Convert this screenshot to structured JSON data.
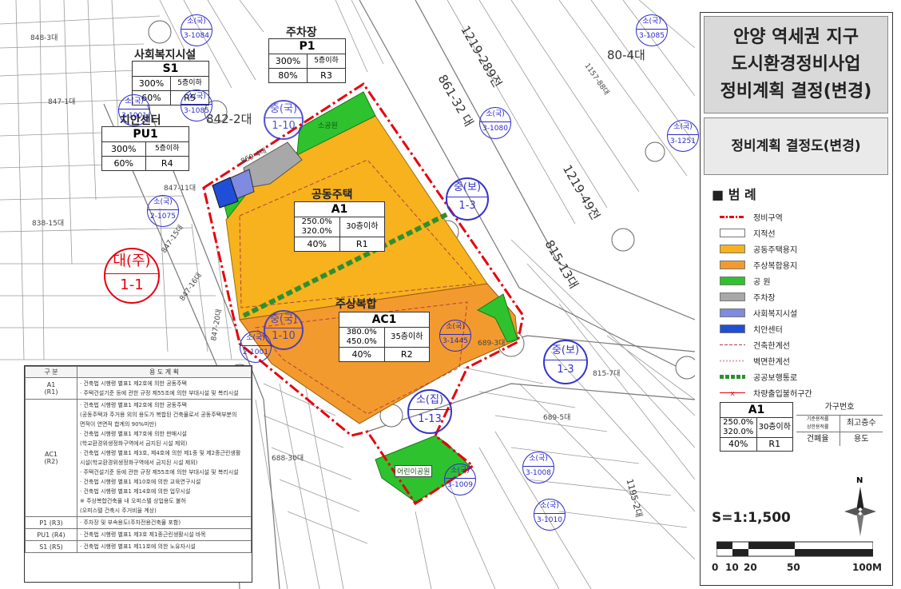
{
  "title": {
    "lines": [
      "안양 역세권 지구",
      "도시환경정비사업",
      "정비계획 결정(변경)"
    ],
    "subtitle": "정비계획 결정도(변경)"
  },
  "legend": {
    "heading": "■ 범  례",
    "items": [
      {
        "label": "정비구역",
        "color": "#e8000c"
      },
      {
        "label": "지적선",
        "color": "#999999"
      },
      {
        "label": "공동주택용지",
        "color": "#f7b21e"
      },
      {
        "label": "주상복합용지",
        "color": "#f39a2e"
      },
      {
        "label": "공   원",
        "color": "#2ec22e"
      },
      {
        "label": "주차장",
        "color": "#a8a8a8"
      },
      {
        "label": "사회복지시설",
        "color": "#7f8ae0"
      },
      {
        "label": "치안센터",
        "color": "#1f4fd6"
      },
      {
        "label": "건축한계선",
        "color": "#e06060"
      },
      {
        "label": "벽면한계선",
        "color": "#e0a0c0"
      },
      {
        "label": "공공보행통로",
        "color": "#2f8f2f"
      },
      {
        "label": "차량출입불허구간",
        "color": "#e8000c"
      }
    ],
    "zone_example": {
      "code": "A1",
      "far1": "250.0%",
      "far2": "320.0%",
      "height": "30층이하",
      "bcr": "40%",
      "id": "R1"
    },
    "zone_explain": {
      "header": "가구번호",
      "far": "기준용적률",
      "far2": "상한용적률",
      "height": "최고층수",
      "bcr": "건폐율",
      "use": "용도"
    },
    "scale": "S=1:1,500",
    "scale_ticks": [
      "0",
      "10",
      "20",
      "50",
      "100M"
    ],
    "north": "N"
  },
  "zones": {
    "S1": {
      "code": "S1",
      "name": "사회복지시설",
      "far": "300%",
      "height": "5층이하",
      "bcr": "60%",
      "id": "R5"
    },
    "P1": {
      "code": "P1",
      "name": "주차장",
      "far": "300%",
      "height": "5층이하",
      "bcr": "80%",
      "id": "R3"
    },
    "PU1": {
      "code": "PU1",
      "name": "치안센터",
      "far": "300%",
      "height": "5층이하",
      "bcr": "60%",
      "id": "R4"
    },
    "A1": {
      "code": "A1",
      "name": "공동주택",
      "far1": "250.0%",
      "far2": "320.0%",
      "height": "30층이하",
      "bcr": "40%",
      "id": "R1"
    },
    "AC1": {
      "code": "AC1",
      "name": "주상복합",
      "far1": "380.0%",
      "far2": "450.0%",
      "height": "35층이하",
      "bcr": "40%",
      "id": "R2"
    }
  },
  "map_labels": {
    "park1": "소공원",
    "park2": "어린이공원",
    "road_861": "861-32 대",
    "road_815": "815-13대",
    "road_1219": "1219-289전",
    "road_1219b": "1219-49전",
    "lot_842": "842-2대",
    "lot_804": "80-4대",
    "lot_847_15": "847-15대",
    "lot_847_16": "847-16대",
    "lot_847_11": "847-11대",
    "lot_847_20": "847-20대",
    "lot_847_1": "847-1대",
    "lot_848": "848-3대",
    "lot_838": "838-15대",
    "lot_1195": "1195-2대",
    "lot_1157": "1157-88대",
    "lot_815_7": "815-7대",
    "lot_869": "869-4대",
    "lot_689_3": "689-3대",
    "lot_689_5": "689-5대",
    "lot_688": "688-30대"
  },
  "circles_big": [
    {
      "top": "대(주)",
      "bottom": "1-1"
    },
    {
      "top": "중(보)",
      "bottom": "1-3"
    },
    {
      "top": "중(보)",
      "bottom": "1-3"
    },
    {
      "top": "소(집)",
      "bottom": "1-13"
    },
    {
      "top": "중(국)",
      "bottom": "1-10"
    },
    {
      "top": "중(국)",
      "bottom": "1-10"
    }
  ],
  "circles_small": [
    {
      "top": "소(국)",
      "bottom": "3-1084"
    },
    {
      "top": "소(국)",
      "bottom": "3-1085"
    },
    {
      "top": "소(국)",
      "bottom": "3-1085"
    },
    {
      "top": "소(국)",
      "bottom": "3-1001"
    },
    {
      "top": "소(국)",
      "bottom": "3-1080"
    },
    {
      "top": "소(국)",
      "bottom": "3-1251"
    },
    {
      "top": "소(국)",
      "bottom": "2-1075"
    },
    {
      "top": "소(국)",
      "bottom": "2-1001"
    },
    {
      "top": "소(국)",
      "bottom": "3-1445"
    },
    {
      "top": "소(국)",
      "bottom": "3-1008"
    },
    {
      "top": "소(국)",
      "bottom": "3-1009"
    },
    {
      "top": "소(국)",
      "bottom": "3-1010"
    }
  ],
  "use_table": {
    "headers": [
      "구 분",
      "용 도 계 획"
    ],
    "rows": [
      {
        "zone": "A1",
        "zone2": "(R1)",
        "lines": [
          "· 건축법 시행령 별표1 제2호에 의한 공동주택",
          "· 주택건설기준 등에 관한 규정 제55조에 의한 부대시설 및 복리시설"
        ]
      },
      {
        "zone": "AC1",
        "zone2": "(R2)",
        "lines": [
          "· 건축법 시행령 별표1 제2호에 의한 공동주택",
          "  (공동주택과 주거용 외의 용도가 복합된 건축물로서 공동주택부분의",
          "  면적이 연면적 합계의 90%미만)",
          "· 건축법 시행령 별표1 제7호에 의한 판매시설",
          "  (학교환경위생정화구역에서 금지된 시설 제외)",
          "· 건축법 시행령 별표1 제3호, 제4호에 의한 제1종 및 제2종근린생활",
          "  시설(학교환경위생정화구역에서 금지된 시설 제외)",
          "· 주택건설기준 등에 관한 규정 제55조에 의한 부대시설 및 복리시설",
          "· 건축법 시행령 별표1 제10호에 의한 교육연구시설",
          "· 건축법 시행령 별표1 제14호에 의한 업무시설",
          "※ 주상복합건축물 내 오피스텔 상업용도 불허",
          "  (오피스텔 건축시 주거비율 계상)"
        ]
      },
      {
        "zone": "P1 (R3)",
        "zone2": "",
        "lines": [
          "· 주차장 및 부속용도(주차전용건축물 포함)"
        ]
      },
      {
        "zone": "PU1 (R4)",
        "zone2": "",
        "lines": [
          "· 건축법 시행령 별표1 제3호 제1종근린생활시설 바목"
        ]
      },
      {
        "zone": "S1 (R5)",
        "zone2": "",
        "lines": [
          "· 건축법 시행령 별표1 제11호에 의한 노유자시설"
        ]
      }
    ]
  }
}
